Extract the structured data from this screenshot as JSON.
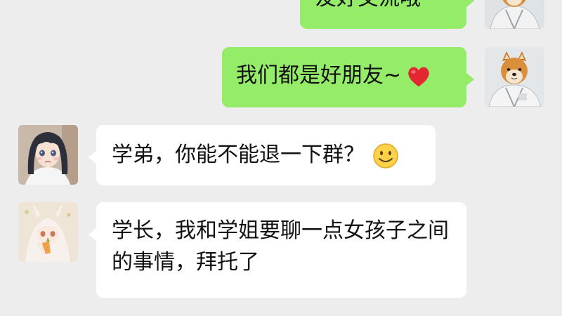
{
  "messages": [
    {
      "side": "out",
      "sender": "me",
      "text": "友好交流哦~",
      "avatar": "shiba-inu-avatar"
    },
    {
      "side": "out",
      "sender": "me",
      "text": "我们都是好朋友~",
      "emoji": "red-heart-icon",
      "avatar": "shiba-inu-avatar"
    },
    {
      "side": "in",
      "sender": "girl-dark-hair",
      "text": "学弟，你能不能退一下群？",
      "emoji": "smiling-face-icon",
      "avatar": "dark-haired-girl-avatar"
    },
    {
      "side": "in",
      "sender": "girl-white-hair",
      "text": "学长，我和学姐要聊一点女孩子之间的事情，拜托了",
      "avatar": "white-haired-girl-avatar"
    }
  ],
  "colors": {
    "background": "#ededed",
    "outgoing_bubble": "#95ec69",
    "incoming_bubble": "#ffffff",
    "text": "#111111"
  }
}
